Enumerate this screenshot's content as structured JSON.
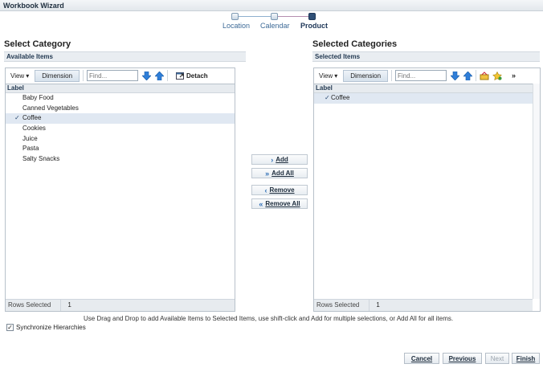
{
  "window": {
    "title": "Workbook Wizard"
  },
  "train": {
    "steps": [
      {
        "label": "Location",
        "current": false
      },
      {
        "label": "Calendar",
        "current": false
      },
      {
        "label": "Product",
        "current": true
      }
    ]
  },
  "left": {
    "section_title": "Select Category",
    "sub_title": "Available Items",
    "view_label": "View",
    "dimension_label": "Dimension",
    "find_placeholder": "Find...",
    "detach_label": "Detach",
    "column_label": "Label",
    "items": [
      {
        "label": "Baby Food",
        "selected": false
      },
      {
        "label": "Canned Vegetables",
        "selected": false
      },
      {
        "label": "Coffee",
        "selected": true
      },
      {
        "label": "Cookies",
        "selected": false
      },
      {
        "label": "Juice",
        "selected": false
      },
      {
        "label": "Pasta",
        "selected": false
      },
      {
        "label": "Salty Snacks",
        "selected": false
      }
    ],
    "rows_selected_label": "Rows Selected",
    "rows_selected_count": "1"
  },
  "right": {
    "section_title": "Selected Categories",
    "sub_title": "Selected Items",
    "view_label": "View",
    "dimension_label": "Dimension",
    "find_placeholder": "Find...",
    "overflow_label": "»",
    "column_label": "Label",
    "items": [
      {
        "label": "Coffee",
        "selected": true
      }
    ],
    "rows_selected_label": "Rows Selected",
    "rows_selected_count": "1"
  },
  "shuttle": {
    "add": "Add",
    "add_all": "Add All",
    "remove": "Remove",
    "remove_all": "Remove All"
  },
  "help_text": "Use Drag and Drop to add Available Items to Selected Items, use shift-click and Add for multiple selections, or Add All for all items.",
  "sync": {
    "label": "Synchronize Hierarchies",
    "checked": true
  },
  "nav": {
    "cancel": "Cancel",
    "previous": "Previous",
    "next": "Next",
    "finish": "Finish"
  },
  "colors": {
    "accent": "#2f4f76",
    "selection": "#e0e8f2",
    "link": "#3d6a97"
  }
}
